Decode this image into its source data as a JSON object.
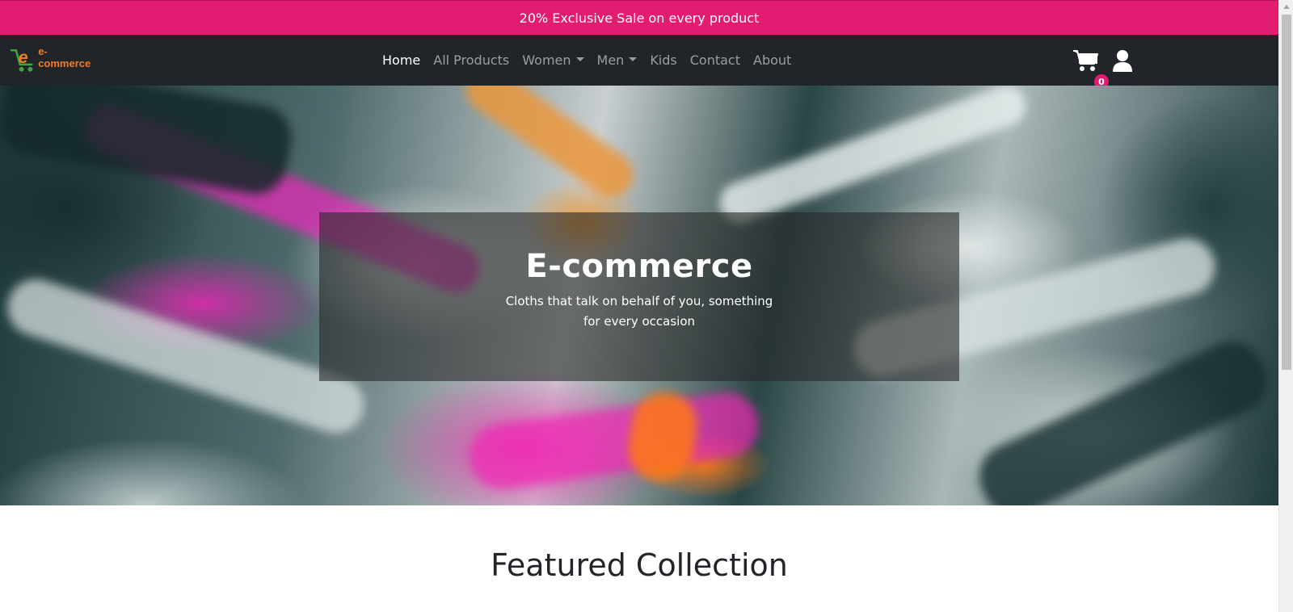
{
  "promo": {
    "text": "20% Exclusive Sale on every product"
  },
  "brand": {
    "logo_text": "e-commerce"
  },
  "nav": {
    "items": [
      {
        "label": "Home",
        "active": true,
        "dropdown": false
      },
      {
        "label": "All Products",
        "active": false,
        "dropdown": false
      },
      {
        "label": "Women",
        "active": false,
        "dropdown": true
      },
      {
        "label": "Men",
        "active": false,
        "dropdown": true
      },
      {
        "label": "Kids",
        "active": false,
        "dropdown": false
      },
      {
        "label": "Contact",
        "active": false,
        "dropdown": false
      },
      {
        "label": "About",
        "active": false,
        "dropdown": false
      }
    ],
    "cart_count": "0",
    "icons": {
      "cart": "cart-icon",
      "user": "user-icon"
    }
  },
  "hero": {
    "title": "E-commerce",
    "subtitle": "Cloths that talk on behalf of you, something for every occasion"
  },
  "featured": {
    "title": "Featured Collection"
  },
  "colors": {
    "promo_bg": "#e31b71",
    "navbar_bg": "#212529",
    "brand_orange": "#f07d26",
    "brand_green": "#3aa845",
    "badge_bg": "#e31b71"
  }
}
